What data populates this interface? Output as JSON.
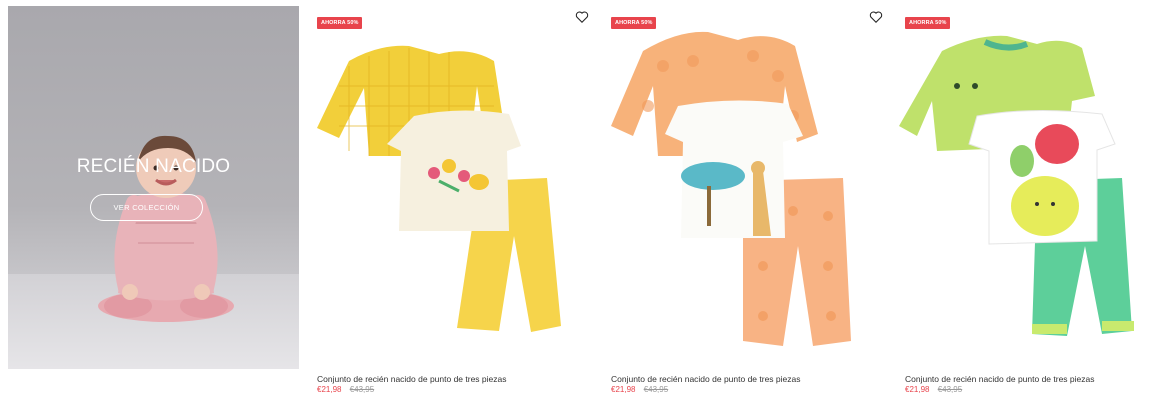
{
  "hero": {
    "title": "RECIÉN NACIDO",
    "button_label": "VER COLECCIÓN"
  },
  "products": [
    {
      "badge": "AHORRA 50%",
      "name": "Conjunto de recién nacido de punto de tres piezas",
      "price": "€21,98",
      "old_price": "€43,95",
      "accent": "#f4d43c"
    },
    {
      "badge": "AHORRA 50%",
      "name": "Conjunto de recién nacido de punto de tres piezas",
      "price": "€21,98",
      "old_price": "€43,95",
      "accent": "#f7b07a"
    },
    {
      "badge": "AHORRA 50%",
      "name": "Conjunto de recién nacido de punto de tres piezas",
      "price": "€21,98",
      "old_price": "€43,95",
      "accent": "#bfe06a"
    }
  ],
  "colors": {
    "sale_red": "#e8444c",
    "text_dark": "#333333",
    "text_muted": "#9a9a9a"
  },
  "icons": {
    "wishlist": "heart-outline-icon"
  }
}
